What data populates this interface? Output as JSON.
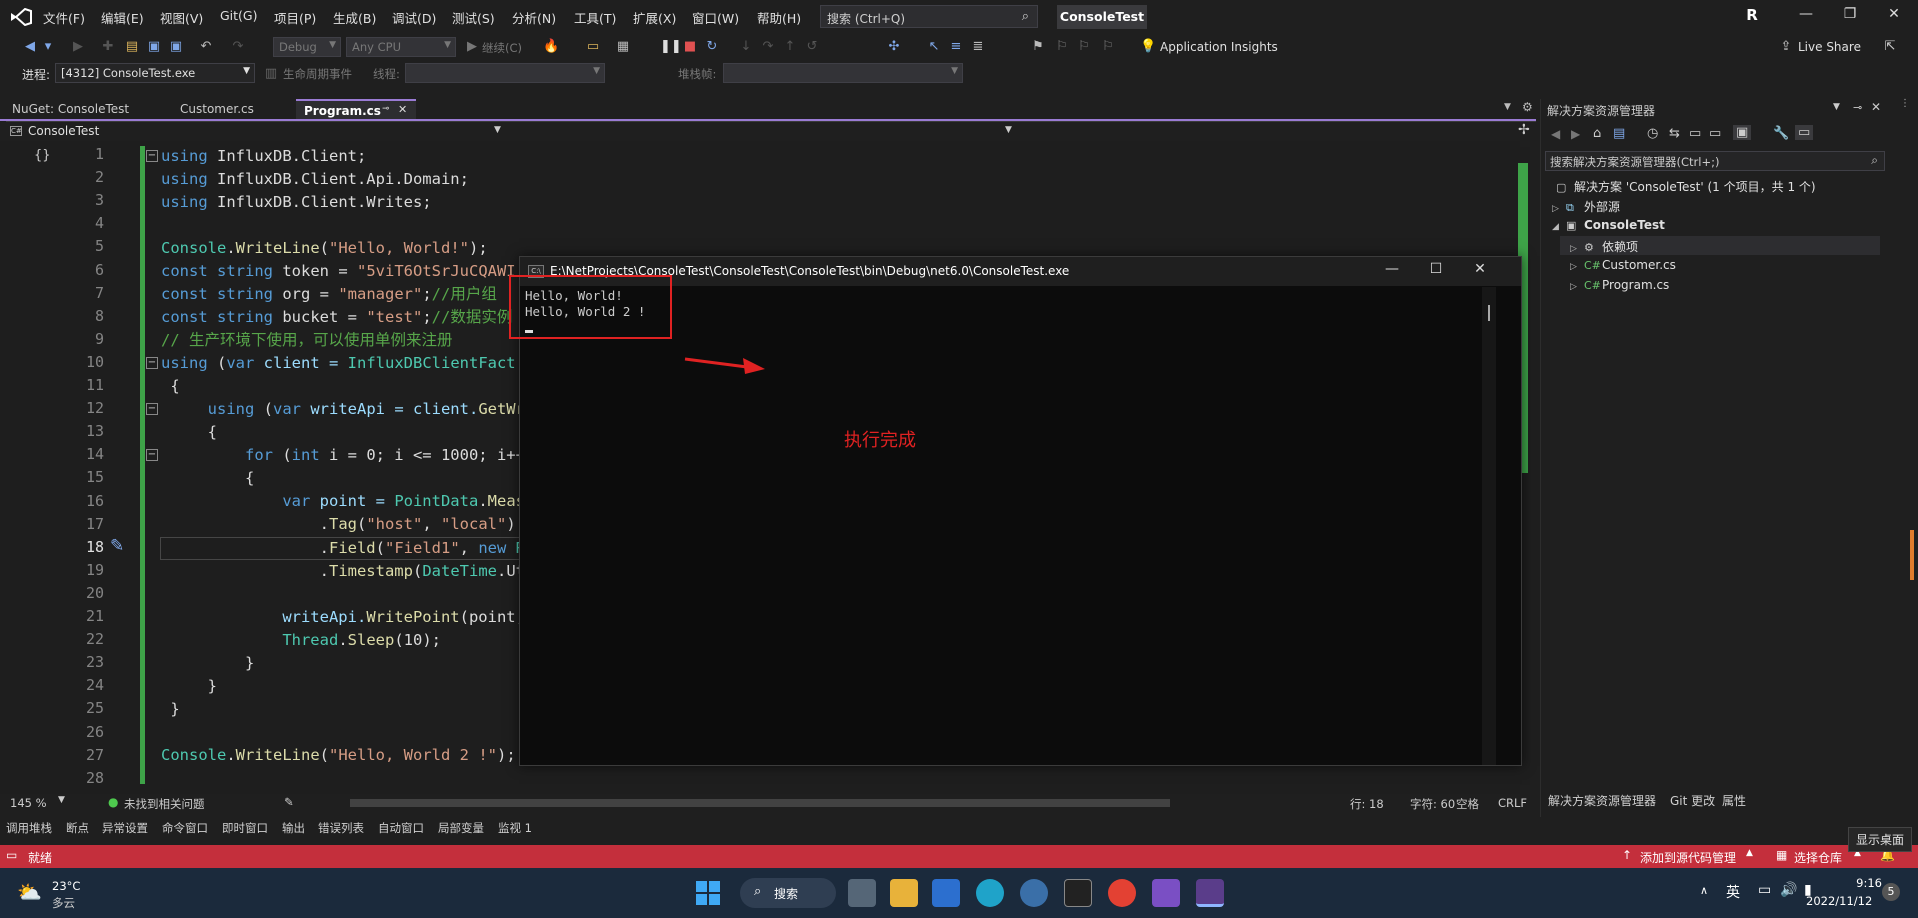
{
  "menubar": {
    "items": [
      "文件(F)",
      "编辑(E)",
      "视图(V)",
      "Git(G)",
      "项目(P)",
      "生成(B)",
      "调试(D)",
      "测试(S)",
      "分析(N)",
      "工具(T)",
      "扩展(X)",
      "窗口(W)",
      "帮助(H)"
    ],
    "search_placeholder": "搜索 (Ctrl+Q)",
    "solution_name": "ConsoleTest",
    "avatar_letter": "R"
  },
  "toolbar": {
    "config": "Debug",
    "platform": "Any CPU",
    "continue_label": "继续(C)",
    "insights": "Application Insights",
    "live_share": "Live Share",
    "process_label": "进程:",
    "process_value": "[4312] ConsoleTest.exe",
    "lifecycle_label": "生命周期事件",
    "thread_label": "线程:",
    "stackframe_label": "堆栈帧:"
  },
  "tabs": [
    {
      "label": "NuGet: ConsoleTest",
      "active": false
    },
    {
      "label": "Customer.cs",
      "active": false
    },
    {
      "label": "Program.cs",
      "active": true
    }
  ],
  "navbar": {
    "project": "ConsoleTest"
  },
  "editor": {
    "line_numbers": [
      "1",
      "2",
      "3",
      "4",
      "5",
      "6",
      "7",
      "8",
      "9",
      "10",
      "11",
      "12",
      "13",
      "14",
      "15",
      "16",
      "17",
      "18",
      "19",
      "20",
      "21",
      "22",
      "23",
      "24",
      "25",
      "26",
      "27",
      "28"
    ],
    "current_line": "18"
  },
  "code": {
    "l1a": "using",
    "l1b": " InfluxDB.Client;",
    "l2a": "using",
    "l2b": " InfluxDB.Client.Api.Domain;",
    "l3a": "using",
    "l3b": " InfluxDB.Client.Writes;",
    "l5a": "Console",
    "l5b": ".",
    "l5c": "WriteLine",
    "l5d": "(",
    "l5e": "\"Hello, World!\"",
    "l5f": ");",
    "l6a": "const",
    "l6b": " string",
    "l6c": " token = ",
    "l6d": "\"5viT6OtSrJuCQAWI",
    "l7a": "const",
    "l7b": " string",
    "l7c": " org = ",
    "l7d": "\"manager\"",
    "l7e": ";",
    "l7f": "//用户组",
    "l8a": "const",
    "l8b": " string",
    "l8c": " bucket = ",
    "l8d": "\"test\"",
    "l8e": ";",
    "l8f": "//数据实例",
    "l9": "// 生产环境下使用，可以使用单例来注册",
    "l10a": "using",
    "l10b": " (",
    "l10c": "var",
    "l10d": " client = ",
    "l10e": "InfluxDBClientFact",
    "l11": " {",
    "l12a": "     using",
    "l12b": " (",
    "l12c": "var",
    "l12d": " writeApi = client.",
    "l12e": "GetWr",
    "l13": "     {",
    "l14a": "         for",
    "l14b": " (",
    "l14c": "int",
    "l14d": " i = 0; i <= 1000; i++",
    "l15": "         {",
    "l16a": "             var",
    "l16b": " point = ",
    "l16c": "PointData",
    "l16d": ".",
    "l16e": "Meas",
    "l17a": "                 .",
    "l17b": "Tag",
    "l17c": "(",
    "l17d": "\"host\"",
    "l17e": ", ",
    "l17f": "\"local\"",
    "l17g": ")",
    "l18a": "                 .",
    "l18b": "Field",
    "l18c": "(",
    "l18d": "\"Field1\"",
    "l18e": ", ",
    "l18f": "new",
    "l18g": " R",
    "l19a": "                 .",
    "l19b": "Timestamp",
    "l19c": "(",
    "l19d": "DateTime",
    "l19e": ".Ut",
    "l21a": "             writeApi.",
    "l21b": "WritePoint",
    "l21c": "(point,",
    "l22a": "             Thread",
    "l22b": ".",
    "l22c": "Sleep",
    "l22d": "(10);",
    "l23": "         }",
    "l24": "     }",
    "l25": " }",
    "l27a": "Console",
    "l27b": ".",
    "l27c": "WriteLine",
    "l27d": "(",
    "l27e": "\"Hello, World 2 !\"",
    "l27f": ");"
  },
  "editor_status": {
    "zoom": "145 %",
    "issues": "未找到相关问题",
    "row": "行: 18",
    "col": "字符: 60",
    "space": "空格",
    "eol": "CRLF"
  },
  "bottom_tabs": [
    "调用堆栈",
    "断点",
    "异常设置",
    "命令窗口",
    "即时窗口",
    "输出",
    "错误列表",
    "自动窗口",
    "局部变量",
    "监视 1"
  ],
  "statusbar": {
    "ready": "就绪",
    "source_control": "添加到源代码管理",
    "repo": "选择仓库"
  },
  "solution_explorer": {
    "title": "解决方案资源管理器",
    "search_placeholder": "搜索解决方案资源管理器(Ctrl+;)",
    "solution_label": "解决方案 'ConsoleTest' (1 个项目，共 1 个)",
    "external": "外部源",
    "project": "ConsoleTest",
    "deps": "依赖项",
    "file1": "Customer.cs",
    "file2": "Program.cs",
    "cs_tag": "C#",
    "bottom_tabs": [
      "解决方案资源管理器",
      "Git 更改",
      "属性"
    ]
  },
  "console": {
    "title": "E:\\NetProjects\\ConsoleTest\\ConsoleTest\\ConsoleTest\\bin\\Debug\\net6.0\\ConsoleTest.exe",
    "icon_text": "C:\\",
    "lines": [
      "Hello, World!",
      "Hello, World 2 !"
    ]
  },
  "annotation": {
    "text": "执行完成"
  },
  "show_desktop": "显示桌面",
  "taskbar": {
    "temp": "23°C",
    "weather": "多云",
    "search": "搜索",
    "ime": "英",
    "time": "9:16",
    "date": "2022/11/12",
    "notif_count": "5"
  },
  "colors": {
    "accent": "#9a7bd4",
    "statusbar": "#c42f3c",
    "annotation": "#e02222",
    "change_bar": "#3ea348"
  }
}
